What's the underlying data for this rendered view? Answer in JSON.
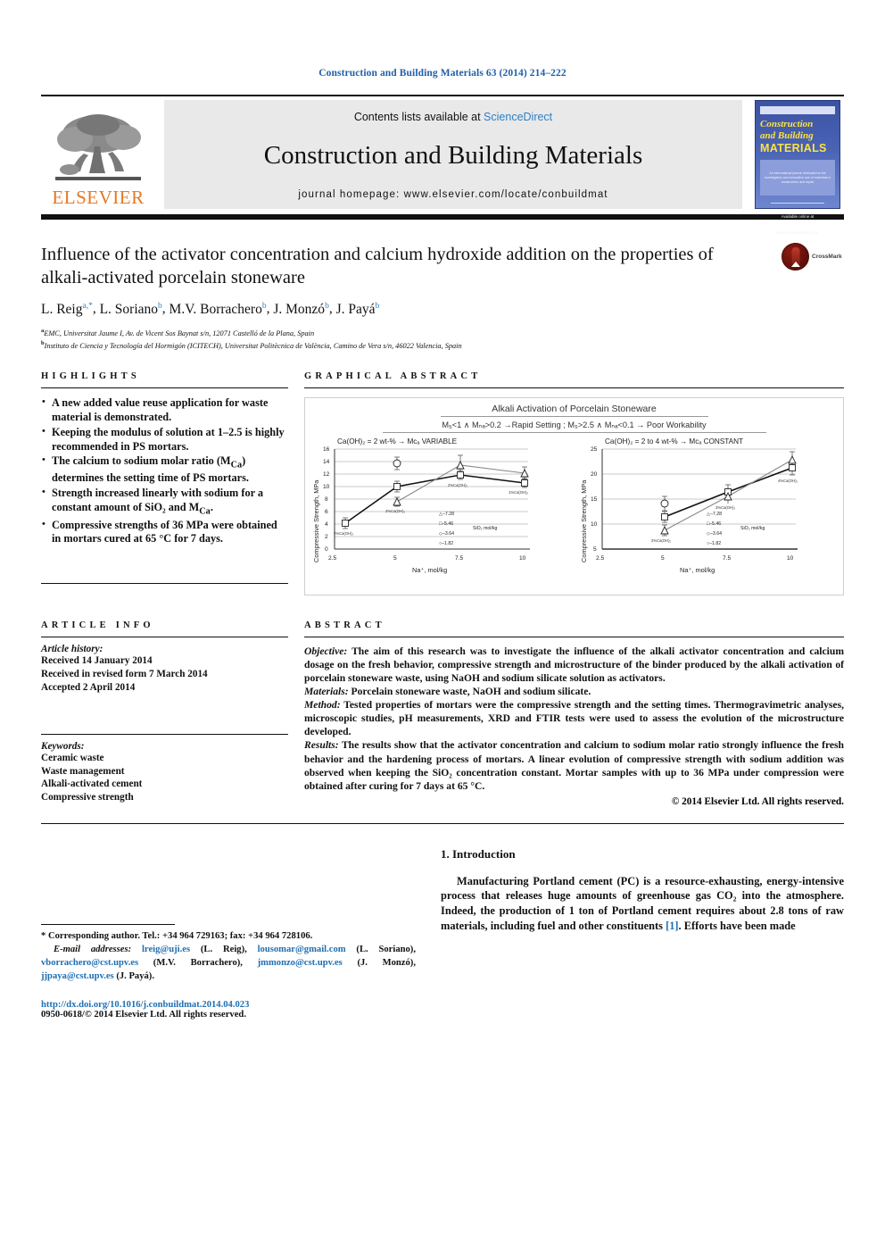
{
  "running_head": "Construction and Building Materials 63 (2014) 214–222",
  "masthead": {
    "contents_prefix": "Contents lists available at ",
    "sciencedirect": "ScienceDirect",
    "journal_title": "Construction and Building Materials",
    "homepage": "journal homepage: www.elsevier.com/locate/conbuildmat",
    "publisher": "ELSEVIER",
    "cover": {
      "line1": "Construction",
      "line2": "and Building",
      "line3": "MATERIALS",
      "blurb": "An international journal dedicated to the investigation and innovative use of materials in construction and repair",
      "foot": "Available online at www.sciencedirect.com"
    }
  },
  "crossmark": {
    "label": "CrossMark"
  },
  "article": {
    "title": "Influence of the activator concentration and calcium hydroxide addition on the properties of alkali-activated porcelain stoneware",
    "authors": [
      {
        "name": "L. Reig",
        "sup": "a,*"
      },
      {
        "name": "L. Soriano",
        "sup": "b"
      },
      {
        "name": "M.V. Borrachero",
        "sup": "b"
      },
      {
        "name": "J. Monzó",
        "sup": "b"
      },
      {
        "name": "J. Payá",
        "sup": "b"
      }
    ],
    "affiliations": [
      {
        "mark": "a",
        "text": "EMC, Universitat Jaume I, Av. de Vicent Sos Baynat s/n, 12071 Castelló de la Plana, Spain"
      },
      {
        "mark": "b",
        "text": "Instituto de Ciencia y Tecnología del Hormigón (ICITECH), Universitat Politècnica de València, Camino de Vera s/n, 46022 Valencia, Spain"
      }
    ]
  },
  "highlights": {
    "heading": "HIGHLIGHTS",
    "items": [
      "A new added value reuse application for waste material is demonstrated.",
      "Keeping the modulus of solution at 1–2.5 is highly recommended in PS mortars.",
      "The calcium to sodium molar ratio (MCa) determines the setting time of PS mortars.",
      "Strength increased linearly with sodium for a constant amount of SiO2 and MCa.",
      "Compressive strengths of 36 MPa were obtained in mortars cured at 65 °C for 7 days."
    ]
  },
  "graphical_abstract": {
    "heading": "GRAPHICAL ABSTRACT"
  },
  "chart_data": [
    {
      "type": "line",
      "title": "Alkali Activation of Porcelain Stoneware",
      "subtitle": "M₅<1 ∧ Mₙₐ>0.2 →Rapid Setting ; M₅>2.5 ∧ Mₙₐ<0.1 → Poor Workability",
      "panel_title": "Ca(OH)₂ = 2 wt-% → Mᴄₐ VARIABLE",
      "xlabel": "Na⁺, mol/kg",
      "ylabel": "Compressive Strength, MPa",
      "xlim": [
        2.5,
        10
      ],
      "ylim": [
        0,
        16
      ],
      "xticks": [
        "2.5",
        "5",
        "7.5",
        "10"
      ],
      "yticks": [
        "0",
        "2",
        "4",
        "6",
        "8",
        "10",
        "12",
        "14",
        "16"
      ],
      "legend_title": "SiO₂ mol/kg",
      "legend": [
        "7.28",
        "5.46",
        "3.64",
        "1.82"
      ],
      "series": [
        {
          "name": "1.82",
          "x": [
            2.9,
            5,
            7.5,
            10
          ],
          "y": [
            4.1,
            9.9,
            11.85,
            10.6
          ],
          "err": [
            0.75,
            0.85,
            0.55,
            0.45
          ]
        },
        {
          "name": "3.64",
          "x": [
            5,
            7.5,
            10
          ],
          "y": [
            7.6,
            13.5,
            12.25
          ],
          "err": [
            0.45,
            1.55,
            0.75
          ]
        },
        {
          "name": "5.46",
          "x": [
            5
          ],
          "y": [
            12.95
          ],
          "err": [
            0.75
          ]
        }
      ],
      "point_labels": [
        "2%Ca(OH)₂",
        "2%Ca(OH)₂",
        "2%Ca(OH)₂",
        "1%Ca(OH)₂"
      ]
    },
    {
      "type": "line",
      "panel_title": "Ca(OH)₂ = 2 to 4 wt-% → Mᴄₐ CONSTANT",
      "xlabel": "Na⁺, mol/kg",
      "ylabel": "Compressive Strength, MPa",
      "xlim": [
        2.5,
        10
      ],
      "ylim": [
        5,
        25
      ],
      "xticks": [
        "2.5",
        "5",
        "7.5",
        "10"
      ],
      "yticks": [
        "5",
        "10",
        "15",
        "20",
        "25"
      ],
      "legend_title": "SiO₂ mol/kg",
      "legend": [
        "7.28",
        "5.46",
        "3.64",
        "1.82"
      ],
      "series": [
        {
          "name": "1.82",
          "x": [
            5,
            7.5,
            10
          ],
          "y": [
            11.5,
            16.5,
            21.3
          ],
          "err": [
            0.8,
            0.9,
            0.9
          ]
        },
        {
          "name": "3.64",
          "x": [
            5,
            7.5,
            10
          ],
          "y": [
            9.8,
            15.8,
            23.2
          ],
          "err": [
            0.6,
            1.1,
            1.2
          ]
        },
        {
          "name": "5.46",
          "x": [
            5
          ],
          "y": [
            14.0
          ],
          "err": [
            0.9
          ]
        }
      ],
      "point_labels": [
        "2%Ca(OH)₂",
        "3%Ca(OH)₂",
        "4%Ca(OH)₂"
      ]
    }
  ],
  "article_info": {
    "heading": "ARTICLE INFO",
    "history_label": "Article history:",
    "history": [
      "Received 14 January 2014",
      "Received in revised form 7 March 2014",
      "Accepted 2 April 2014"
    ],
    "keywords_label": "Keywords:",
    "keywords": [
      "Ceramic waste",
      "Waste management",
      "Alkali-activated cement",
      "Compressive strength"
    ]
  },
  "abstract": {
    "heading": "ABSTRACT",
    "paragraphs": [
      {
        "label": "Objective:",
        "text": " The aim of this research was to investigate the influence of the alkali activator concentration and calcium dosage on the fresh behavior, compressive strength and microstructure of the binder produced by the alkali activation of porcelain stoneware waste, using NaOH and sodium silicate solution as activators."
      },
      {
        "label": "Materials:",
        "text": " Porcelain stoneware waste, NaOH and sodium silicate."
      },
      {
        "label": "Method:",
        "text": " Tested properties of mortars were the compressive strength and the setting times. Thermogravimetric analyses, microscopic studies, pH measurements, XRD and FTIR tests were used to assess the evolution of the microstructure developed."
      },
      {
        "label": "Results:",
        "text": " The results show that the activator concentration and calcium to sodium molar ratio strongly influence the fresh behavior and the hardening process of mortars. A linear evolution of compressive strength with sodium addition was observed when keeping the SiO2 concentration constant. Mortar samples with up to 36 MPa under compression were obtained after curing for 7 days at 65 °C."
      }
    ],
    "copyright": "© 2014 Elsevier Ltd. All rights reserved."
  },
  "footnote": {
    "corresponding": "* Corresponding author. Tel.: +34 964 729163; fax: +34 964 728106.",
    "email_label": "E-mail addresses:",
    "emails": [
      {
        "addr": "lreig@uji.es",
        "who": "(L. Reig),"
      },
      {
        "addr": "lousomar@gmail.com",
        "who": "(L. Soriano),"
      },
      {
        "addr": "vborrachero@cst.upv.es",
        "who": "(M.V. Borrachero),"
      },
      {
        "addr": "jmmonzo@cst.upv.es",
        "who": "(J. Monzó),"
      },
      {
        "addr": "jjpaya@cst.upv.es",
        "who": "(J. Payá)."
      }
    ],
    "doi": "http://dx.doi.org/10.1016/j.conbuildmat.2014.04.023",
    "issn": "0950-0618/© 2014 Elsevier Ltd. All rights reserved."
  },
  "intro": {
    "heading": "1. Introduction",
    "paragraph_pre": "Manufacturing Portland cement (PC) is a resource-exhausting, energy-intensive process that releases huge amounts of greenhouse gas CO2 into the atmosphere. Indeed, the production of 1 ton of Portland cement requires about 2.8 tons of raw materials, including fuel and other constituents ",
    "ref": "[1]",
    "paragraph_post": ". Efforts have been made"
  }
}
